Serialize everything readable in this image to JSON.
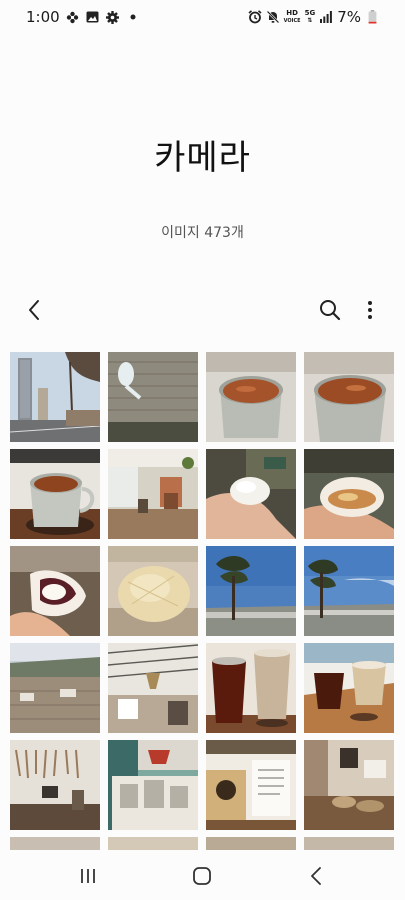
{
  "status_bar": {
    "time": "1:00",
    "battery": "7%",
    "hd_label": "HD",
    "network_label": "5G",
    "left_icons": [
      "flower-notification-icon",
      "gallery-notification-icon",
      "settings-notification-icon",
      "dot-notification-icon"
    ],
    "right_icons": [
      "alarm-icon",
      "mute-icon",
      "hd-voice-icon",
      "5g-icon",
      "signal-icon",
      "battery-icon"
    ]
  },
  "album": {
    "title": "카메라",
    "count_label": "이미지 473개"
  },
  "toolbar": {
    "back_icon": "chevron-left-icon",
    "search_icon": "search-icon",
    "more_icon": "more-vertical-icon"
  },
  "photos": [
    "street-with-tower",
    "spoon-on-wall",
    "coffee-cup",
    "coffee-cup",
    "coffee-cup-table",
    "cafe-interior",
    "hand-holding-bun",
    "hand-holding-bun-filling",
    "hand-holding-red-bean-bun",
    "melon-bread",
    "pine-tree-sea",
    "pine-tree-sea",
    "outdoor-terrace",
    "cafe-chandelier",
    "iced-coffee-drinks",
    "drinks-tray",
    "cafe-wall-decor",
    "bookshelf-desk",
    "menu-board",
    "cafe-shelf",
    "partial-row",
    "partial-row",
    "partial-row",
    "partial-row"
  ],
  "navbar": {
    "recent_icon": "recent-apps-icon",
    "home_icon": "home-icon",
    "back_icon": "back-icon"
  }
}
